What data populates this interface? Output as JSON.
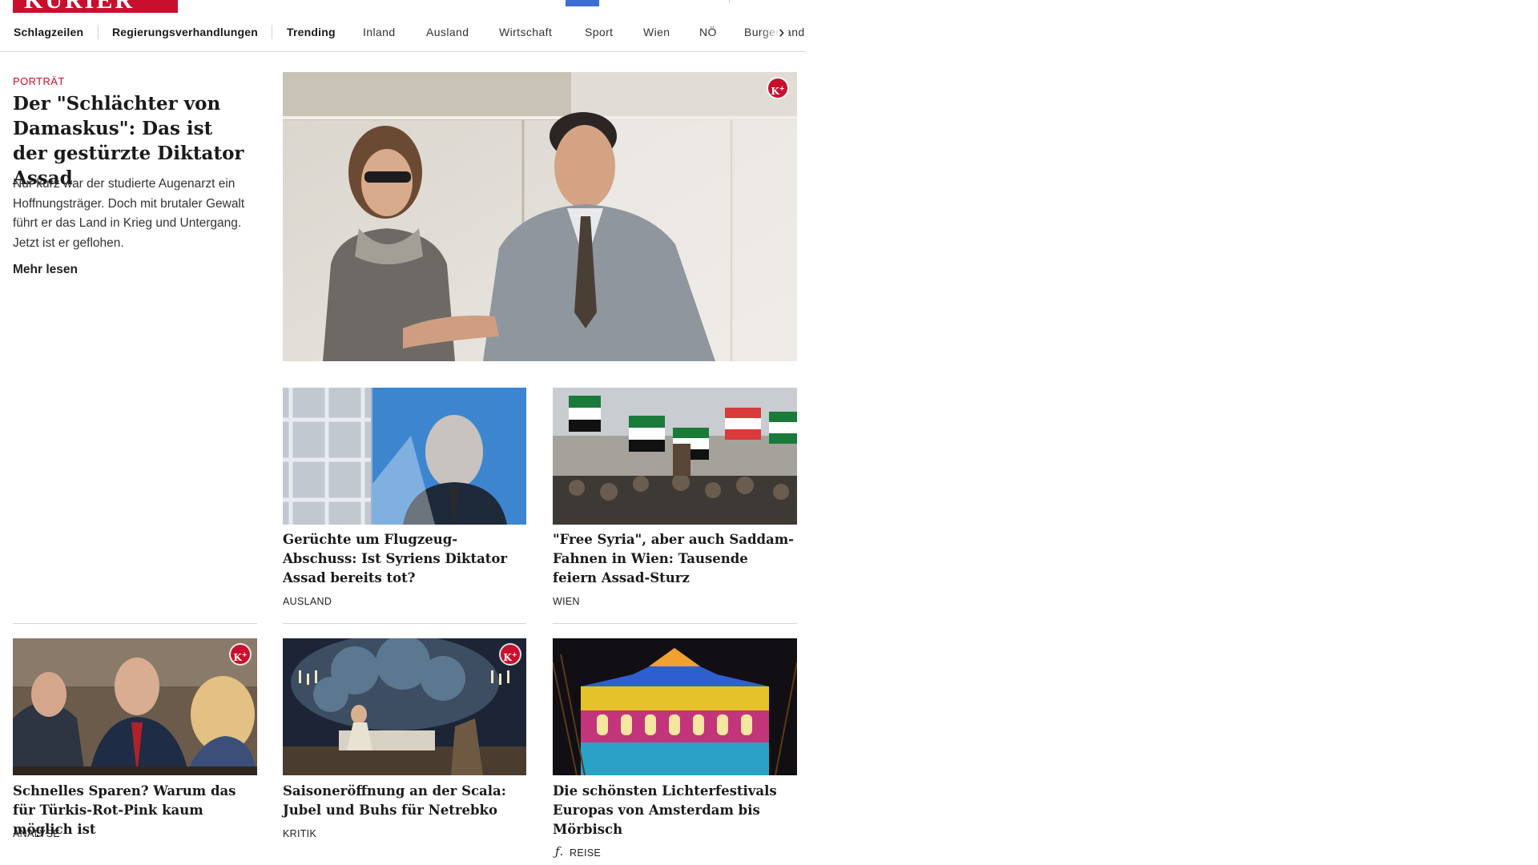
{
  "brand": {
    "name": "KURIER",
    "color": "#c8102e"
  },
  "nav": {
    "items": [
      {
        "label": "Schlagzeilen"
      },
      {
        "label": "Regierungsverhandlungen"
      },
      {
        "label": "Trending"
      },
      {
        "label": "Inland"
      },
      {
        "label": "Ausland"
      },
      {
        "label": "Wirtschaft"
      },
      {
        "label": "Sport"
      },
      {
        "label": "Wien"
      },
      {
        "label": "NÖ"
      },
      {
        "label": "Burgenland"
      }
    ],
    "next_icon": "chevron-right-icon"
  },
  "lead": {
    "kicker": "Porträt",
    "title": "Der \"Schlächter von Da­maskus\": Das ist der ge­stürzte Diktator Assad",
    "teaser": "Nur kurz war der studierte Augenarzt ein Hoffnungsträger. Doch mit brutaler Gewalt führt er das Land in Krieg und Untergang. Jetzt ist er geflohen.",
    "more_label": "Mehr lesen",
    "premium": true
  },
  "cards": [
    {
      "title": "Gerüchte um Flugzeug-Abschuss: Ist Syriens Diktator Assad bereits tot?",
      "category": "Ausland",
      "premium": false
    },
    {
      "title": "\"Free Syria\", aber auch Saddam-Fahnen in Wien: Tausende feiern Assad-Sturz",
      "category": "Wien",
      "premium": false
    },
    {
      "title": "Schnelles Sparen? Warum das für Türkis-Rot-Pink kaum möglich ist",
      "category": "Analyse",
      "premium": true
    },
    {
      "title": "Saisoneröffnung an der Scala: Ju­bel und Buhs für Netrebko",
      "category": "Kritik",
      "premium": true
    },
    {
      "title": "Die schönsten Lichterfestivals Eu­ropas von Amsterdam bis Mörbisch",
      "category": "Reise",
      "premium": false,
      "category_icon": "italic-f-icon"
    }
  ],
  "premium_badge": "K+",
  "colors": {
    "accent": "#c8102e",
    "link_blue": "#3b6fd4"
  }
}
